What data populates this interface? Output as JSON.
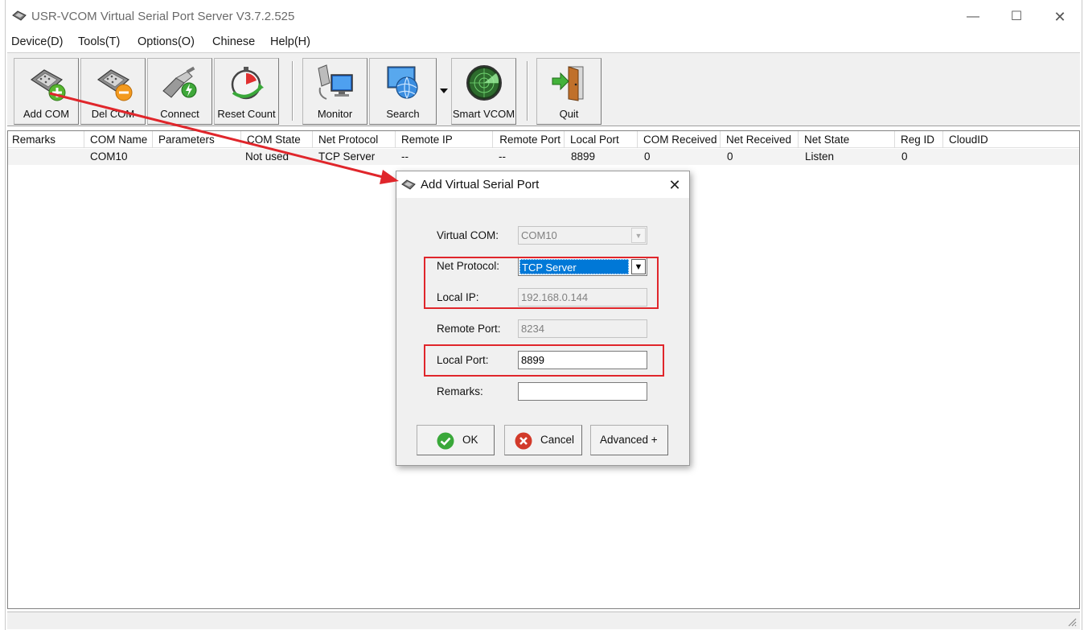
{
  "window": {
    "title": "USR-VCOM Virtual Serial Port Server V3.7.2.525",
    "min_glyph": "—",
    "max_glyph": "☐",
    "close_glyph": "✕"
  },
  "menu": [
    "Device(D)",
    "Tools(T)",
    "Options(O)",
    "Chinese",
    "Help(H)"
  ],
  "toolbar": {
    "add_com": "Add COM",
    "del_com": "Del COM",
    "connect": "Connect",
    "reset_count": "Reset Count",
    "monitor": "Monitor",
    "search": "Search",
    "smart_vcom": "Smart VCOM",
    "quit": "Quit"
  },
  "table": {
    "headers": [
      "Remarks",
      "COM Name",
      "Parameters",
      "COM State",
      "Net Protocol",
      "Remote IP",
      "Remote Port",
      "Local Port",
      "COM Received",
      "Net Received",
      "Net State",
      "Reg ID",
      "CloudID"
    ],
    "rows": [
      {
        "remarks": "",
        "com_name": "COM10",
        "parameters": "",
        "com_state": "Not used",
        "net_protocol": "TCP Server",
        "remote_ip": "--",
        "remote_port": "--",
        "local_port": "8899",
        "com_received": "0",
        "net_received": "0",
        "net_state": "Listen",
        "reg_id": "0",
        "cloud_id": ""
      }
    ]
  },
  "dialog": {
    "title": "Add Virtual Serial Port",
    "close_glyph": "✕",
    "virtual_com_label": "Virtual COM:",
    "virtual_com_value": "COM10",
    "net_protocol_label": "Net Protocol:",
    "net_protocol_value": "TCP Server",
    "local_ip_label": "Local IP:",
    "local_ip_value": "192.168.0.144",
    "remote_port_label": "Remote Port:",
    "remote_port_value": "8234",
    "local_port_label": "Local Port:",
    "local_port_value": "8899",
    "remarks_label": "Remarks:",
    "remarks_value": "",
    "ok_label": "OK",
    "cancel_label": "Cancel",
    "advanced_label": "Advanced +"
  },
  "colors": {
    "annotation_red": "#e0262b",
    "selection_blue": "#0078d7",
    "ok_green": "#3aa83a",
    "cancel_red": "#d23a2a"
  }
}
